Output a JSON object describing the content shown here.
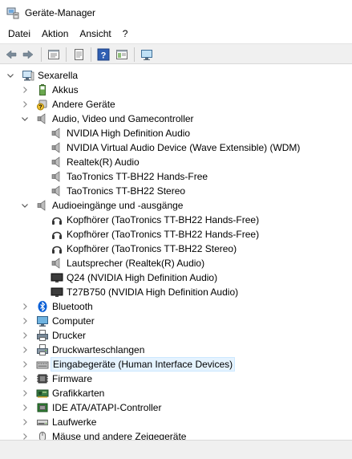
{
  "window": {
    "title": "Geräte-Manager"
  },
  "menu": [
    "Datei",
    "Aktion",
    "Ansicht",
    "?"
  ],
  "toolbar": [
    {
      "name": "back-button",
      "icon": "arrow-left-icon"
    },
    {
      "name": "forward-button",
      "icon": "arrow-right-icon"
    },
    {
      "name": "properties-view-button",
      "icon": "properties-icon"
    },
    {
      "name": "update-driver-button",
      "icon": "driver-icon"
    },
    {
      "name": "help-button",
      "icon": "help-icon"
    },
    {
      "name": "view-button",
      "icon": "view-icon"
    },
    {
      "name": "scan-hardware-button",
      "icon": "monitor-scan-icon"
    }
  ],
  "tree": [
    {
      "label": "Sexarella",
      "level": 0,
      "expander": "open",
      "icon": "computer-icon"
    },
    {
      "label": "Akkus",
      "level": 1,
      "expander": "closed",
      "icon": "battery-icon"
    },
    {
      "label": "Andere Geräte",
      "level": 1,
      "expander": "closed",
      "icon": "unknown-device-icon"
    },
    {
      "label": "Audio, Video und Gamecontroller",
      "level": 1,
      "expander": "open",
      "icon": "speaker-icon"
    },
    {
      "label": "NVIDIA High Definition Audio",
      "level": 2,
      "expander": "none",
      "icon": "speaker-icon"
    },
    {
      "label": "NVIDIA Virtual Audio Device (Wave Extensible) (WDM)",
      "level": 2,
      "expander": "none",
      "icon": "speaker-icon"
    },
    {
      "label": "Realtek(R) Audio",
      "level": 2,
      "expander": "none",
      "icon": "speaker-icon"
    },
    {
      "label": "TaoTronics TT-BH22 Hands-Free",
      "level": 2,
      "expander": "none",
      "icon": "speaker-icon"
    },
    {
      "label": "TaoTronics TT-BH22 Stereo",
      "level": 2,
      "expander": "none",
      "icon": "speaker-icon"
    },
    {
      "label": "Audioeingänge und -ausgänge",
      "level": 1,
      "expander": "open",
      "icon": "speaker-icon"
    },
    {
      "label": "Kopfhörer (TaoTronics TT-BH22 Hands-Free)",
      "level": 2,
      "expander": "none",
      "icon": "headphones-icon"
    },
    {
      "label": "Kopfhörer (TaoTronics TT-BH22 Hands-Free)",
      "level": 2,
      "expander": "none",
      "icon": "headphones-icon"
    },
    {
      "label": "Kopfhörer (TaoTronics TT-BH22 Stereo)",
      "level": 2,
      "expander": "none",
      "icon": "headphones-icon"
    },
    {
      "label": "Lautsprecher (Realtek(R) Audio)",
      "level": 2,
      "expander": "none",
      "icon": "speaker-icon"
    },
    {
      "label": "Q24 (NVIDIA High Definition Audio)",
      "level": 2,
      "expander": "none",
      "icon": "display-audio-icon"
    },
    {
      "label": "T27B750 (NVIDIA High Definition Audio)",
      "level": 2,
      "expander": "none",
      "icon": "display-audio-icon"
    },
    {
      "label": "Bluetooth",
      "level": 1,
      "expander": "closed",
      "icon": "bluetooth-icon"
    },
    {
      "label": "Computer",
      "level": 1,
      "expander": "closed",
      "icon": "monitor-icon"
    },
    {
      "label": "Drucker",
      "level": 1,
      "expander": "closed",
      "icon": "printer-icon"
    },
    {
      "label": "Druckwarteschlangen",
      "level": 1,
      "expander": "closed",
      "icon": "print-queue-icon"
    },
    {
      "label": "Eingabegeräte (Human Interface Devices)",
      "level": 1,
      "expander": "closed",
      "icon": "hid-icon",
      "selected": true
    },
    {
      "label": "Firmware",
      "level": 1,
      "expander": "closed",
      "icon": "firmware-icon"
    },
    {
      "label": "Grafikkarten",
      "level": 1,
      "expander": "closed",
      "icon": "display-adapter-icon"
    },
    {
      "label": "IDE ATA/ATAPI-Controller",
      "level": 1,
      "expander": "closed",
      "icon": "ide-controller-icon"
    },
    {
      "label": "Laufwerke",
      "level": 1,
      "expander": "closed",
      "icon": "drive-icon"
    },
    {
      "label": "Mäuse und andere Zeigegeräte",
      "level": 1,
      "expander": "closed",
      "icon": "mouse-icon"
    }
  ],
  "colors": {
    "selection_bg": "#e5f3ff",
    "selection_border": "#cce8ff",
    "bluetooth": "#0a5fd6",
    "toolbar_bg": "#f0f0f0"
  }
}
